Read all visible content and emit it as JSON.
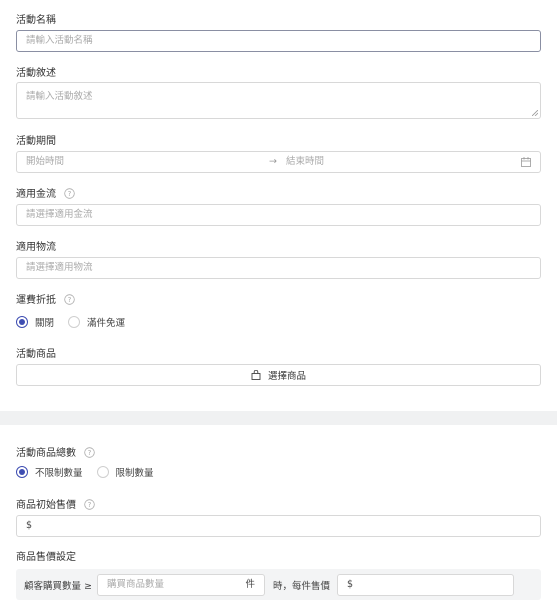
{
  "name": {
    "label": "活動名稱",
    "placeholder": "請輸入活動名稱"
  },
  "description": {
    "label": "活動敘述",
    "placeholder": "請輸入活動敘述"
  },
  "period": {
    "label": "活動期間",
    "start_placeholder": "開始時間",
    "arrow": "→",
    "end_placeholder": "結束時間"
  },
  "payment": {
    "label": "適用金流",
    "placeholder": "請選擇適用金流"
  },
  "logistics": {
    "label": "適用物流",
    "placeholder": "請選擇適用物流"
  },
  "shipping_discount": {
    "label": "運費折抵",
    "options": [
      "關閉",
      "滿件免運"
    ],
    "selected": 0
  },
  "products": {
    "label": "活動商品",
    "button_label": "選擇商品"
  },
  "total_quantity": {
    "label": "活動商品總數",
    "options": [
      "不限制數量",
      "限制數量"
    ],
    "selected": 0
  },
  "initial_price": {
    "label": "商品初始售價",
    "value": "$"
  },
  "price_settings": {
    "label": "商品售價設定",
    "row_prefix": "顧客購買數量 ≥",
    "quantity_placeholder": "購買商品數量",
    "unit": "件",
    "row_middle": "時，每件售價",
    "price_value": "$"
  },
  "colors": {
    "accent": "#3e4db2",
    "border": "#d8d8d8",
    "divider": "#f0f1f2"
  }
}
